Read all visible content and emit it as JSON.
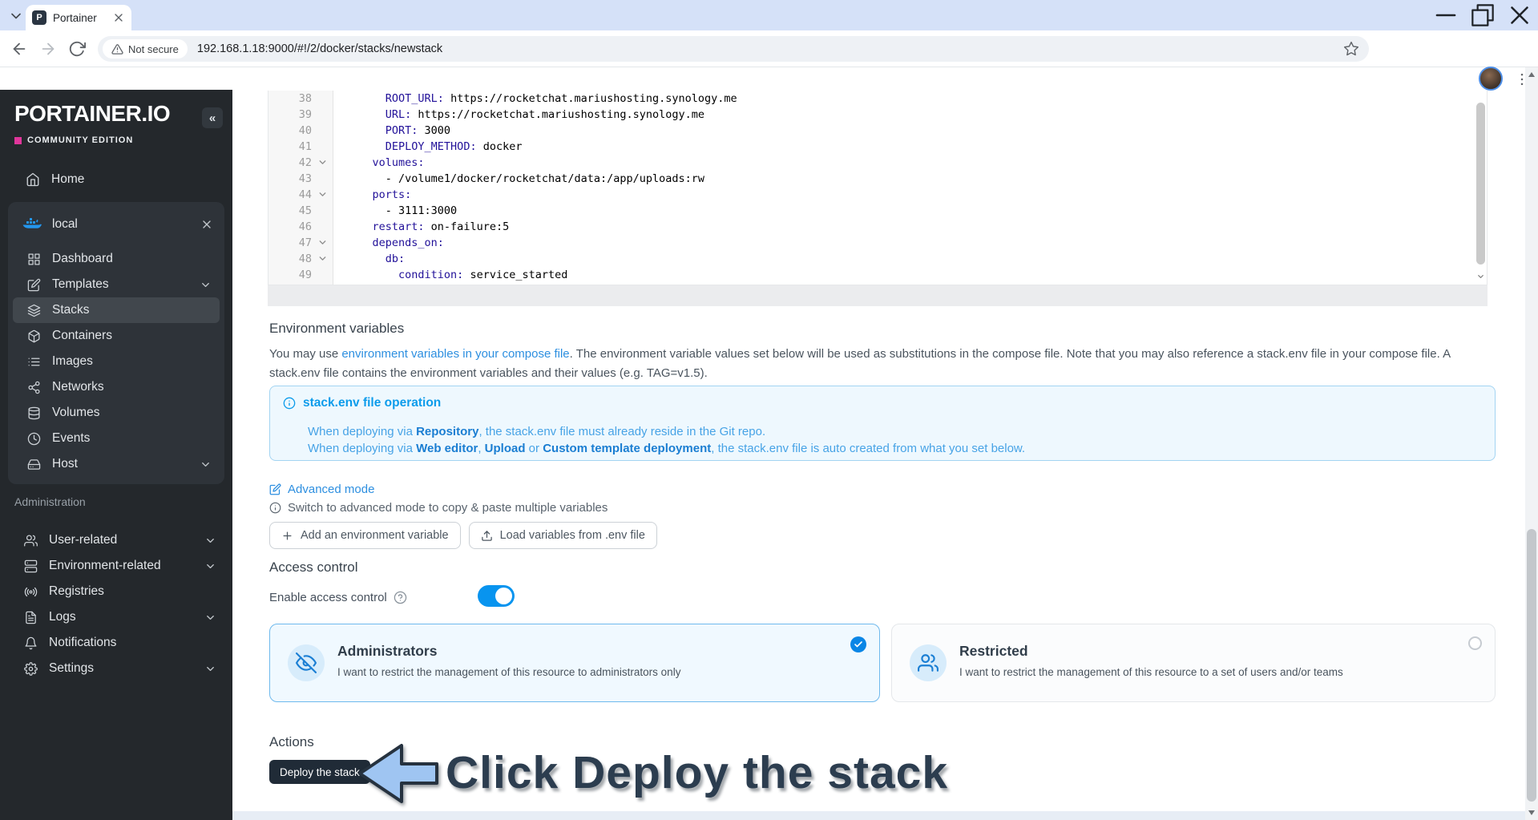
{
  "browser": {
    "tab_title": "Portainer",
    "favicon_letter": "P",
    "security_label": "Not secure",
    "url": "192.168.1.18:9000/#!/2/docker/stacks/newstack"
  },
  "sidebar": {
    "logo": "PORTAINER.IO",
    "edition": "COMMUNITY EDITION",
    "collapse_glyph": "«",
    "home_label": "Home",
    "environment_name": "local",
    "env_items": [
      {
        "label": "Dashboard",
        "icon": "dashboard-icon"
      },
      {
        "label": "Templates",
        "icon": "templates-icon",
        "chevron": true
      },
      {
        "label": "Stacks",
        "icon": "stacks-icon",
        "active": true
      },
      {
        "label": "Containers",
        "icon": "containers-icon"
      },
      {
        "label": "Images",
        "icon": "images-icon"
      },
      {
        "label": "Networks",
        "icon": "networks-icon"
      },
      {
        "label": "Volumes",
        "icon": "volumes-icon"
      },
      {
        "label": "Events",
        "icon": "events-icon"
      },
      {
        "label": "Host",
        "icon": "host-icon",
        "chevron": true
      }
    ],
    "admin_label": "Administration",
    "admin_items": [
      {
        "label": "User-related",
        "icon": "users-icon",
        "chevron": true
      },
      {
        "label": "Environment-related",
        "icon": "environments-icon",
        "chevron": true
      },
      {
        "label": "Registries",
        "icon": "registries-icon"
      },
      {
        "label": "Logs",
        "icon": "logs-icon",
        "chevron": true
      },
      {
        "label": "Notifications",
        "icon": "notifications-icon"
      },
      {
        "label": "Settings",
        "icon": "settings-icon",
        "chevron": true
      }
    ]
  },
  "editor": {
    "lines": [
      {
        "num": 38,
        "parts": [
          {
            "t": "      "
          },
          {
            "t": "ROOT_URL:",
            "k": true
          },
          {
            "t": " https://rocketchat.mariushosting.synology.me"
          }
        ]
      },
      {
        "num": 39,
        "parts": [
          {
            "t": "      "
          },
          {
            "t": "URL:",
            "k": true
          },
          {
            "t": " https://rocketchat.mariushosting.synology.me"
          }
        ]
      },
      {
        "num": 40,
        "parts": [
          {
            "t": "      "
          },
          {
            "t": "PORT:",
            "k": true
          },
          {
            "t": " 3000"
          }
        ]
      },
      {
        "num": 41,
        "parts": [
          {
            "t": "      "
          },
          {
            "t": "DEPLOY_METHOD:",
            "k": true
          },
          {
            "t": " docker"
          }
        ]
      },
      {
        "num": 42,
        "fold": true,
        "parts": [
          {
            "t": "    "
          },
          {
            "t": "volumes:",
            "k": true
          }
        ]
      },
      {
        "num": 43,
        "parts": [
          {
            "t": "      - /volume1/docker/rocketchat/data:/app/uploads:rw"
          }
        ]
      },
      {
        "num": 44,
        "fold": true,
        "parts": [
          {
            "t": "    "
          },
          {
            "t": "ports:",
            "k": true
          }
        ]
      },
      {
        "num": 45,
        "parts": [
          {
            "t": "      - 3111:3000"
          }
        ]
      },
      {
        "num": 46,
        "parts": [
          {
            "t": "    "
          },
          {
            "t": "restart:",
            "k": true
          },
          {
            "t": " on-failure:5"
          }
        ]
      },
      {
        "num": 47,
        "fold": true,
        "parts": [
          {
            "t": "    "
          },
          {
            "t": "depends_on:",
            "k": true
          }
        ]
      },
      {
        "num": 48,
        "fold": true,
        "parts": [
          {
            "t": "      "
          },
          {
            "t": "db:",
            "k": true
          }
        ]
      },
      {
        "num": 49,
        "parts": [
          {
            "t": "        "
          },
          {
            "t": "condition:",
            "k": true
          },
          {
            "t": " service_started"
          }
        ]
      }
    ]
  },
  "env_section": {
    "title": "Environment variables",
    "para_before": "You may use ",
    "para_link": "environment variables in your compose file",
    "para_after": ". The environment variable values set below will be used as substitutions in the compose file. Note that you may also reference a stack.env file in your compose file. A stack.env file contains the environment variables and their values (e.g. TAG=v1.5).",
    "advanced_link": "Advanced mode",
    "advanced_hint": "Switch to advanced mode to copy & paste multiple variables",
    "buttons": [
      {
        "label": "Add an environment variable",
        "icon": "plus-icon"
      },
      {
        "label": "Load variables from .env file",
        "icon": "upload-icon"
      }
    ]
  },
  "info_box": {
    "title": "stack.env file operation",
    "lines": [
      [
        {
          "t": "When deploying via "
        },
        {
          "t": "Repository",
          "b": true
        },
        {
          "t": ", the stack.env file must already reside in the Git repo."
        }
      ],
      [
        {
          "t": "When deploying via "
        },
        {
          "t": "Web editor",
          "b": true
        },
        {
          "t": ", "
        },
        {
          "t": "Upload",
          "b": true
        },
        {
          "t": " or "
        },
        {
          "t": "Custom template deployment",
          "b": true
        },
        {
          "t": ", the stack.env file is auto created from what you set below."
        }
      ]
    ]
  },
  "access_control": {
    "title": "Access control",
    "enable_label": "Enable access control",
    "enabled": true,
    "options": [
      {
        "title": "Administrators",
        "desc": "I want to restrict the management of this resource to administrators only",
        "icon": "eye-off-icon",
        "selected": true
      },
      {
        "title": "Restricted",
        "desc": "I want to restrict the management of this resource to a set of users and/or teams",
        "icon": "team-icon",
        "selected": false
      }
    ]
  },
  "actions": {
    "title": "Actions",
    "deploy_label": "Deploy the stack"
  },
  "annotation": {
    "text": "Click Deploy the stack"
  },
  "colors": {
    "accent_blue": "#0d9ceb",
    "docker_blue": "#2496ed",
    "pink_badge": "#e0369b",
    "selected_card_border": "#6fb9ed",
    "deploy_button_bg": "#202b37",
    "annotation_arrow_fill": "#9fc5f2",
    "annotation_text": "#2c3d4f",
    "code_key": "#221199"
  }
}
